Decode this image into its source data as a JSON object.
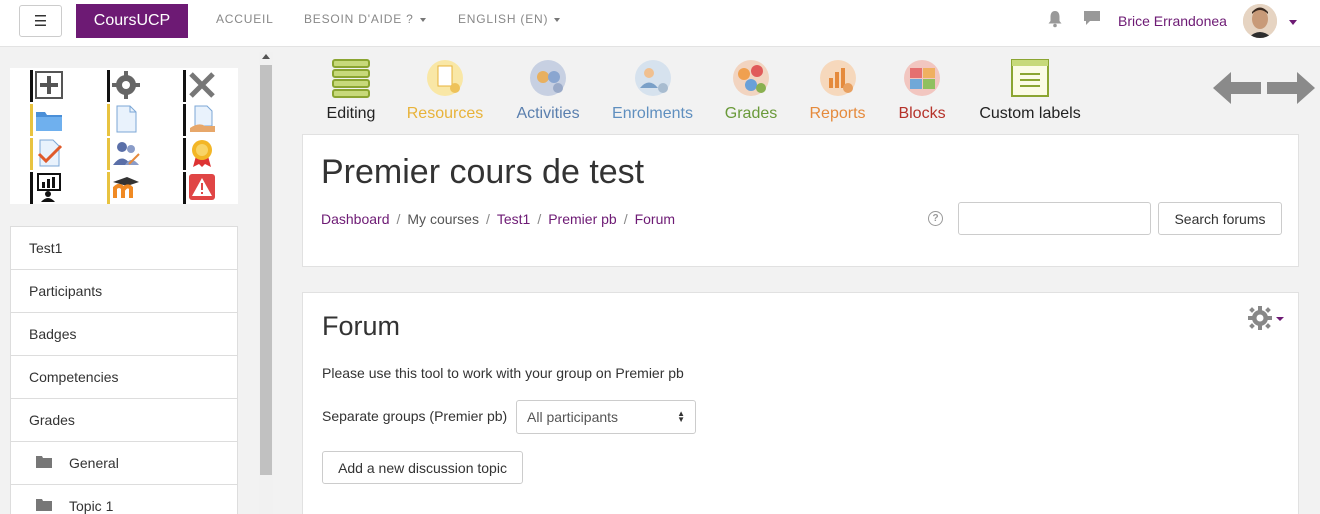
{
  "navbar": {
    "menu_glyph": "☰",
    "brand": "CoursUCP",
    "links": [
      {
        "label": "ACCUEIL"
      },
      {
        "label": "BESOIN D'AIDE ?"
      },
      {
        "label": "ENGLISH (EN)"
      }
    ],
    "user_name": "Brice Errandonea",
    "accent_color": "#6d1a74"
  },
  "quick_icons": [
    "add-icon",
    "gear-icon",
    "delete-icon",
    "folder-icon",
    "file-icon",
    "file-share-icon",
    "assignment-icon",
    "users-icon",
    "badge-icon",
    "report-icon",
    "moodle-icon",
    "warning-icon"
  ],
  "sidebar": {
    "items": [
      {
        "label": "Test1"
      },
      {
        "label": "Participants"
      },
      {
        "label": "Badges"
      },
      {
        "label": "Competencies"
      },
      {
        "label": "Grades"
      },
      {
        "label": "General"
      },
      {
        "label": "Topic 1"
      }
    ]
  },
  "toolbar": {
    "items": [
      {
        "label": "Editing",
        "color": "#222222"
      },
      {
        "label": "Resources",
        "color": "#e8b33a"
      },
      {
        "label": "Activities",
        "color": "#5a7fae"
      },
      {
        "label": "Enrolments",
        "color": "#5f8fbf"
      },
      {
        "label": "Grades",
        "color": "#6a9a3a"
      },
      {
        "label": "Reports",
        "color": "#e58a3c"
      },
      {
        "label": "Blocks",
        "color": "#b5322a"
      },
      {
        "label": "Custom labels",
        "color": "#222222"
      }
    ]
  },
  "header": {
    "title": "Premier cours de test",
    "breadcrumb": [
      "Dashboard",
      "My courses",
      "Test1",
      "Premier pb",
      "Forum"
    ],
    "help_glyph": "?",
    "search_placeholder": "",
    "search_button": "Search forums"
  },
  "forum": {
    "title": "Forum",
    "description": "Please use this tool to work with your group on Premier pb",
    "group_label": "Separate groups (Premier pb)",
    "group_value": "All participants",
    "add_button": "Add a new discussion topic"
  }
}
